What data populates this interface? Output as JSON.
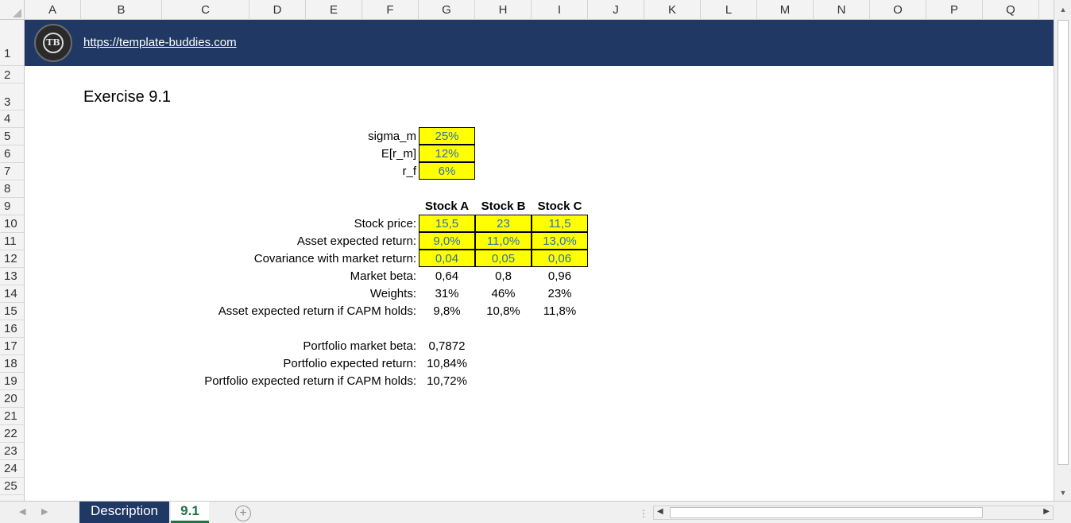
{
  "columns": [
    "A",
    "B",
    "C",
    "D",
    "E",
    "F",
    "G",
    "H",
    "I",
    "J",
    "K",
    "L",
    "M",
    "N",
    "O",
    "P",
    "Q"
  ],
  "rows": [
    "1",
    "2",
    "3",
    "4",
    "5",
    "6",
    "7",
    "8",
    "9",
    "10",
    "11",
    "12",
    "13",
    "14",
    "15",
    "16",
    "17",
    "18",
    "19",
    "20",
    "21",
    "22",
    "23",
    "24",
    "25"
  ],
  "banner": {
    "logo_text": "TB",
    "url": "https://template-buddies.com"
  },
  "title": "Exercise 9.1",
  "params": [
    {
      "label": "sigma_m",
      "value": "25%"
    },
    {
      "label": "E[r_m]",
      "value": "12%"
    },
    {
      "label": "r_f",
      "value": "6%"
    }
  ],
  "stock_headers": [
    "Stock A",
    "Stock B",
    "Stock C"
  ],
  "stock_rows": [
    {
      "label": "Stock price:",
      "values": [
        "15,5",
        "23",
        "11,5"
      ],
      "input": true
    },
    {
      "label": "Asset expected return:",
      "values": [
        "9,0%",
        "11,0%",
        "13,0%"
      ],
      "input": true
    },
    {
      "label": "Covariance with market return:",
      "values": [
        "0,04",
        "0,05",
        "0,06"
      ],
      "input": true
    },
    {
      "label": "Market beta:",
      "values": [
        "0,64",
        "0,8",
        "0,96"
      ],
      "input": false
    },
    {
      "label": "Weights:",
      "values": [
        "31%",
        "46%",
        "23%"
      ],
      "input": false
    },
    {
      "label": "Asset expected return if CAPM holds:",
      "values": [
        "9,8%",
        "10,8%",
        "11,8%"
      ],
      "input": false
    }
  ],
  "portfolio": [
    {
      "label": "Portfolio market beta:",
      "value": "0,7872"
    },
    {
      "label": "Portfolio expected return:",
      "value": "10,84%"
    },
    {
      "label": "Portfolio expected return if CAPM holds:",
      "value": "10,72%"
    }
  ],
  "tabs": {
    "description": "Description",
    "active": "9.1"
  },
  "icons": {
    "add_sheet": "plus-circle-icon",
    "split": "split-handle-icon"
  },
  "colors": {
    "banner": "#203864",
    "input_fill": "#ffff00",
    "input_text": "#2f6eb5",
    "active_tab": "#217346"
  }
}
